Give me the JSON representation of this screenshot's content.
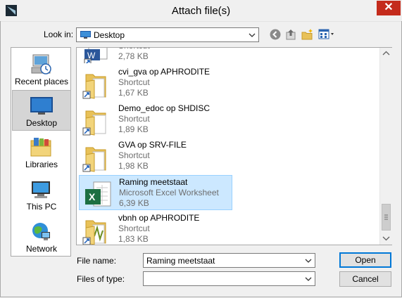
{
  "window": {
    "title": "Attach file(s)",
    "close_label": "✕"
  },
  "toolbar": {
    "look_in_label": "Look in:",
    "look_in_value": "Desktop",
    "icons": [
      "back-icon",
      "up-folder-icon",
      "new-folder-icon",
      "view-menu-icon"
    ]
  },
  "places": [
    {
      "label": "Recent places",
      "icon": "recent-places-icon"
    },
    {
      "label": "Desktop",
      "icon": "desktop-icon",
      "selected": true
    },
    {
      "label": "Libraries",
      "icon": "libraries-icon"
    },
    {
      "label": "This PC",
      "icon": "this-pc-icon"
    },
    {
      "label": "Network",
      "icon": "network-icon"
    }
  ],
  "files": [
    {
      "name": "",
      "type": "Shortcut",
      "size": "2,78 KB",
      "icon": "word-shortcut-icon"
    },
    {
      "name": "cvi_gva op APHRODITE",
      "type": "Shortcut",
      "size": "1,67 KB",
      "icon": "folder-shortcut-icon"
    },
    {
      "name": "Demo_edoc op SHDISC",
      "type": "Shortcut",
      "size": "1,89 KB",
      "icon": "folder-shortcut-icon"
    },
    {
      "name": "GVA op SRV-FILE",
      "type": "Shortcut",
      "size": "1,98 KB",
      "icon": "folder-shortcut-icon"
    },
    {
      "name": "Raming meetstaat",
      "type": "Microsoft Excel Worksheet",
      "size": "6,39 KB",
      "icon": "excel-icon",
      "selected": true
    },
    {
      "name": "vbnh op APHRODITE",
      "type": "Shortcut",
      "size": "1,83 KB",
      "icon": "folder-shortcut-icon"
    }
  ],
  "form": {
    "file_name_label": "File name:",
    "file_name_value": "Raming meetstaat",
    "file_type_label": "Files of type:",
    "file_type_value": "",
    "open_label": "Open",
    "cancel_label": "Cancel"
  },
  "colors": {
    "close": "#c42b1c",
    "selection": "#cce8ff",
    "excel": "#1d6f42",
    "folder": "#e8c158"
  }
}
